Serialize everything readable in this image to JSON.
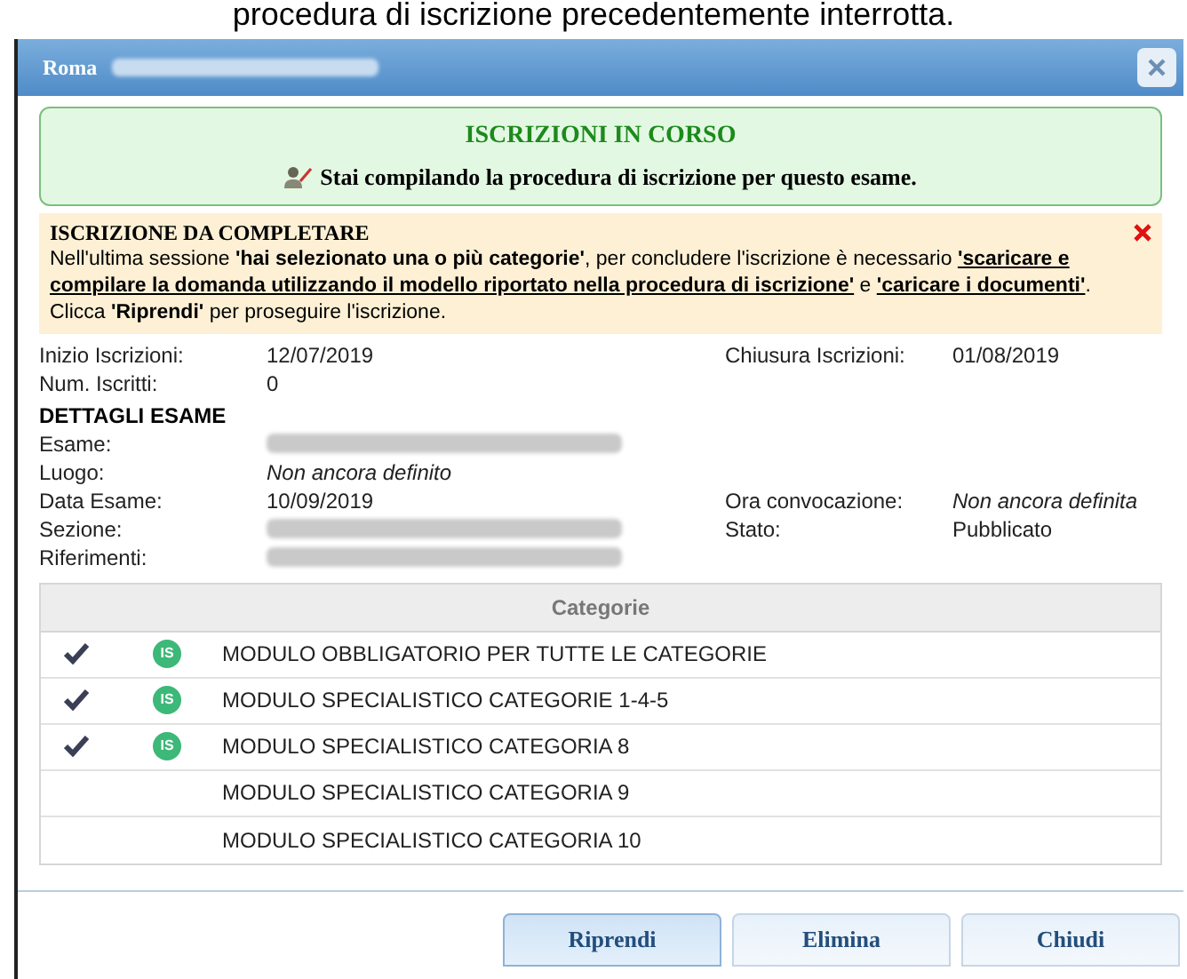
{
  "caption": "procedura di iscrizione precedentemente interrotta.",
  "window": {
    "title": "Roma"
  },
  "status_box": {
    "title": "ISCRIZIONI IN CORSO",
    "message": "Stai compilando la procedura di iscrizione per questo esame."
  },
  "notice": {
    "title": "ISCRIZIONE DA COMPLETARE",
    "paragraphs": [
      [
        {
          "kind": "text",
          "text": "Nell'ultima sessione "
        },
        {
          "kind": "bold",
          "text": "'hai selezionato una o più categorie'"
        },
        {
          "kind": "text",
          "text": ", per concludere l'iscrizione è necessario "
        },
        {
          "kind": "emphasis",
          "text": "'scaricare e compilare la domanda utilizzando il modello riportato nella procedura di iscrizione'"
        },
        {
          "kind": "text",
          "text": " e "
        },
        {
          "kind": "emphasis",
          "text": "'caricare i documenti'"
        },
        {
          "kind": "text",
          "text": "."
        }
      ],
      [
        {
          "kind": "text",
          "text": "Clicca "
        },
        {
          "kind": "bold",
          "text": "'Riprendi'"
        },
        {
          "kind": "text",
          "text": " per proseguire l'iscrizione."
        }
      ]
    ]
  },
  "summary": [
    [
      {
        "label": "Inizio Iscrizioni:",
        "value": "12/07/2019",
        "italic": false
      },
      {
        "label": "Chiusura Iscrizioni:",
        "value": "01/08/2019",
        "italic": false
      }
    ],
    [
      {
        "label": "Num. Iscritti:",
        "value": "0",
        "italic": false
      }
    ]
  ],
  "details": {
    "title": "DETTAGLI ESAME",
    "rows": [
      [
        {
          "label": "Esame:",
          "redacted": true
        }
      ],
      [
        {
          "label": "Luogo:",
          "value": "Non ancora definito",
          "italic": true
        }
      ],
      [
        {
          "label": "Data Esame:",
          "value": "10/09/2019",
          "italic": false
        },
        {
          "label": "Ora convocazione:",
          "value": "Non ancora definita",
          "italic": true
        }
      ],
      [
        {
          "label": "Sezione:",
          "redacted": true
        },
        {
          "label": "Stato:",
          "value": "Pubblicato",
          "italic": false
        }
      ],
      [
        {
          "label": "Riferimenti:",
          "redacted": true
        }
      ]
    ]
  },
  "table": {
    "column": "Categorie",
    "rows": [
      {
        "name": "MODULO OBBLIGATORIO PER TUTTE LE CATEGORIE",
        "checked": true,
        "badge": "IS"
      },
      {
        "name": "MODULO SPECIALISTICO CATEGORIE 1-4-5",
        "checked": true,
        "badge": "IS"
      },
      {
        "name": "MODULO SPECIALISTICO CATEGORIA 8",
        "checked": true,
        "badge": "IS"
      },
      {
        "name": "MODULO SPECIALISTICO CATEGORIA 9",
        "checked": false
      },
      {
        "name": "MODULO SPECIALISTICO CATEGORIA 10",
        "checked": false
      }
    ]
  },
  "buttons": [
    {
      "label": "Riprendi",
      "default": true
    },
    {
      "label": "Elimina",
      "default": false
    },
    {
      "label": "Chiudi",
      "default": false
    }
  ]
}
